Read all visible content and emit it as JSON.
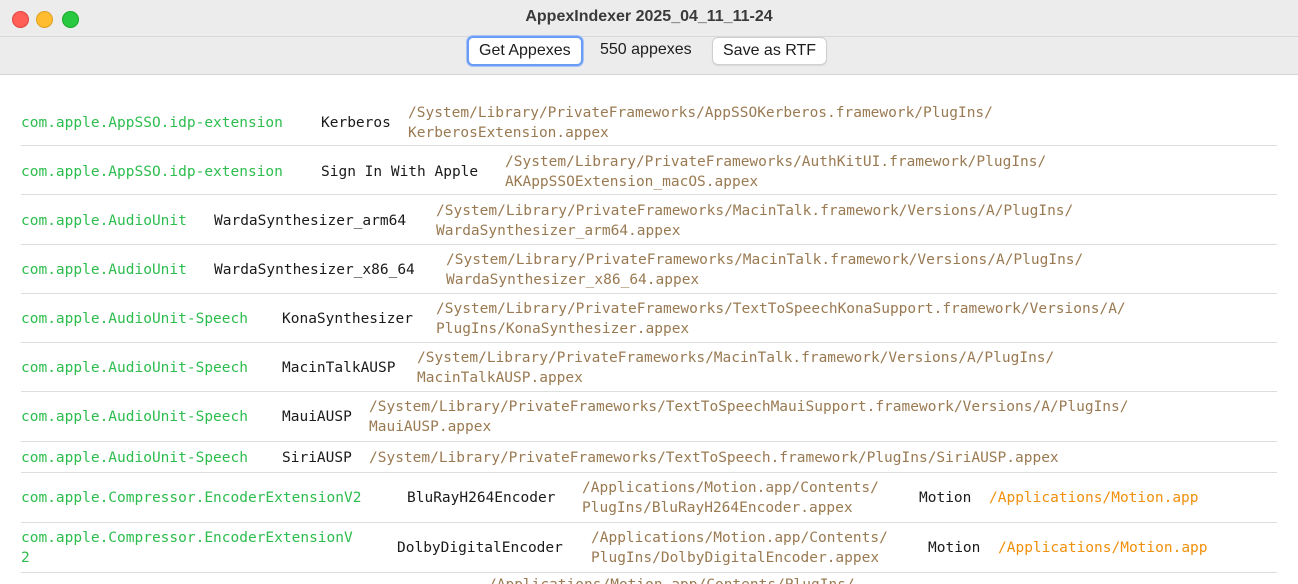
{
  "window": {
    "title": "AppexIndexer 2025_04_11_11-24"
  },
  "toolbar": {
    "get_label": "Get Appexes",
    "count_label": "550 appexes",
    "save_label": "Save as RTF"
  },
  "colors": {
    "bundle_id": "#2dbd4e",
    "path": "#9a7a52",
    "app_path": "#f0900c",
    "focus_ring": "#6a9cf5"
  },
  "rows": [
    {
      "bundle_id": "com.apple.AppSSO.idp-extension",
      "name": "Kerberos",
      "path_line1": "/System/Library/PrivateFrameworks/AppSSOKerberos.framework/PlugIns/",
      "path_line2": "KerberosExtension.appex"
    },
    {
      "bundle_id": "com.apple.AppSSO.idp-extension",
      "name": "Sign In With Apple",
      "path_line1": "/System/Library/PrivateFrameworks/AuthKitUI.framework/PlugIns/",
      "path_line2": "AKAppSSOExtension_macOS.appex"
    },
    {
      "bundle_id": "com.apple.AudioUnit",
      "name": "WardaSynthesizer_arm64",
      "path_line1": "/System/Library/PrivateFrameworks/MacinTalk.framework/Versions/A/PlugIns/",
      "path_line2": "WardaSynthesizer_arm64.appex"
    },
    {
      "bundle_id": "com.apple.AudioUnit",
      "name": "WardaSynthesizer_x86_64",
      "path_line1": "/System/Library/PrivateFrameworks/MacinTalk.framework/Versions/A/PlugIns/",
      "path_line2": "WardaSynthesizer_x86_64.appex"
    },
    {
      "bundle_id": "com.apple.AudioUnit-Speech",
      "name": "KonaSynthesizer",
      "path_line1": "/System/Library/PrivateFrameworks/TextToSpeechKonaSupport.framework/Versions/A/",
      "path_line2": "PlugIns/KonaSynthesizer.appex"
    },
    {
      "bundle_id": "com.apple.AudioUnit-Speech",
      "name": "MacinTalkAUSP",
      "path_line1": "/System/Library/PrivateFrameworks/MacinTalk.framework/Versions/A/PlugIns/",
      "path_line2": "MacinTalkAUSP.appex"
    },
    {
      "bundle_id": "com.apple.AudioUnit-Speech",
      "name": "MauiAUSP",
      "path_line1": "/System/Library/PrivateFrameworks/TextToSpeechMauiSupport.framework/Versions/A/PlugIns/",
      "path_line2": "MauiAUSP.appex"
    },
    {
      "bundle_id": "com.apple.AudioUnit-Speech",
      "name": "SiriAUSP",
      "path_line1": "/System/Library/PrivateFrameworks/TextToSpeech.framework/PlugIns/SiriAUSP.appex"
    },
    {
      "bundle_id": "com.apple.Compressor.EncoderExtensionV2",
      "name": "BluRayH264Encoder",
      "path_line1": "/Applications/Motion.app/Contents/",
      "path_line2": "PlugIns/BluRayH264Encoder.appex",
      "app_name": "Motion",
      "app_path": "/Applications/Motion.app"
    },
    {
      "bundle_id_line1": "com.apple.Compressor.EncoderExtensionV",
      "bundle_id_line2": "2",
      "name": "DolbyDigitalEncoder",
      "path_line1": "/Applications/Motion.app/Contents/",
      "path_line2": "PlugIns/DolbyDigitalEncoder.appex",
      "app_name": "Motion",
      "app_path": "/Applications/Motion.app"
    },
    {
      "path_line1": "/Applications/Motion.app/Contents/PlugIns/"
    }
  ]
}
